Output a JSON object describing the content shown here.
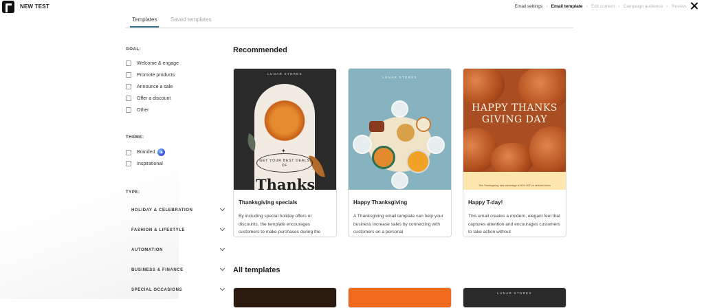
{
  "app": {
    "title": "NEW TEST"
  },
  "steps": [
    "Email settings",
    "Email template",
    "Edit content",
    "Campaign audience",
    "Review"
  ],
  "tabs": {
    "templates": "Templates",
    "saved": "Saved templates"
  },
  "filters": {
    "goal_title": "GOAL:",
    "goal_items": [
      "Welcome & engage",
      "Promote products",
      "Announce a sale",
      "Offer a discount",
      "Other"
    ],
    "theme_title": "THEME:",
    "theme_items": [
      "Branded",
      "Inspirational"
    ],
    "type_title": "TYPE:",
    "type_items": [
      "HOLIDAY & CELEBRATION",
      "FASHION & LIFESTYLE",
      "AUTOMATION",
      "BUSINESS & FINANCE",
      "SPECIAL OCCASIONS"
    ]
  },
  "recommended": {
    "title": "Recommended",
    "cards": [
      {
        "title": "Thanksgiving specials",
        "desc": "By including special holiday offers or discounts, the template encourages customers to make purchases during the",
        "thumb_store": "LUNAR STORES",
        "thumb_oval": "GET YOUR BEST DEALS OF",
        "thumb_word": "Thanks"
      },
      {
        "title": "Happy Thanksgiving",
        "desc": "A Thanksgiving email template can help your business increase sales by connecting with customers on a personal",
        "thumb_store": "LUNAR STORES"
      },
      {
        "title": "Happy T-day!",
        "desc": "This email creates a modern, elegant feel that captures attention and encourages customers to take action without",
        "thumb_heading": "HAPPY THANKS GIVING DAY",
        "thumb_strip": "This Thanksgiving, take advantage of 30% OFF on selected items"
      }
    ]
  },
  "all_templates": {
    "title": "All templates",
    "card3_store": "LUNAR STORES"
  },
  "colors": {
    "accent": "#2c6f86",
    "card_border": "#dcdcdc"
  }
}
